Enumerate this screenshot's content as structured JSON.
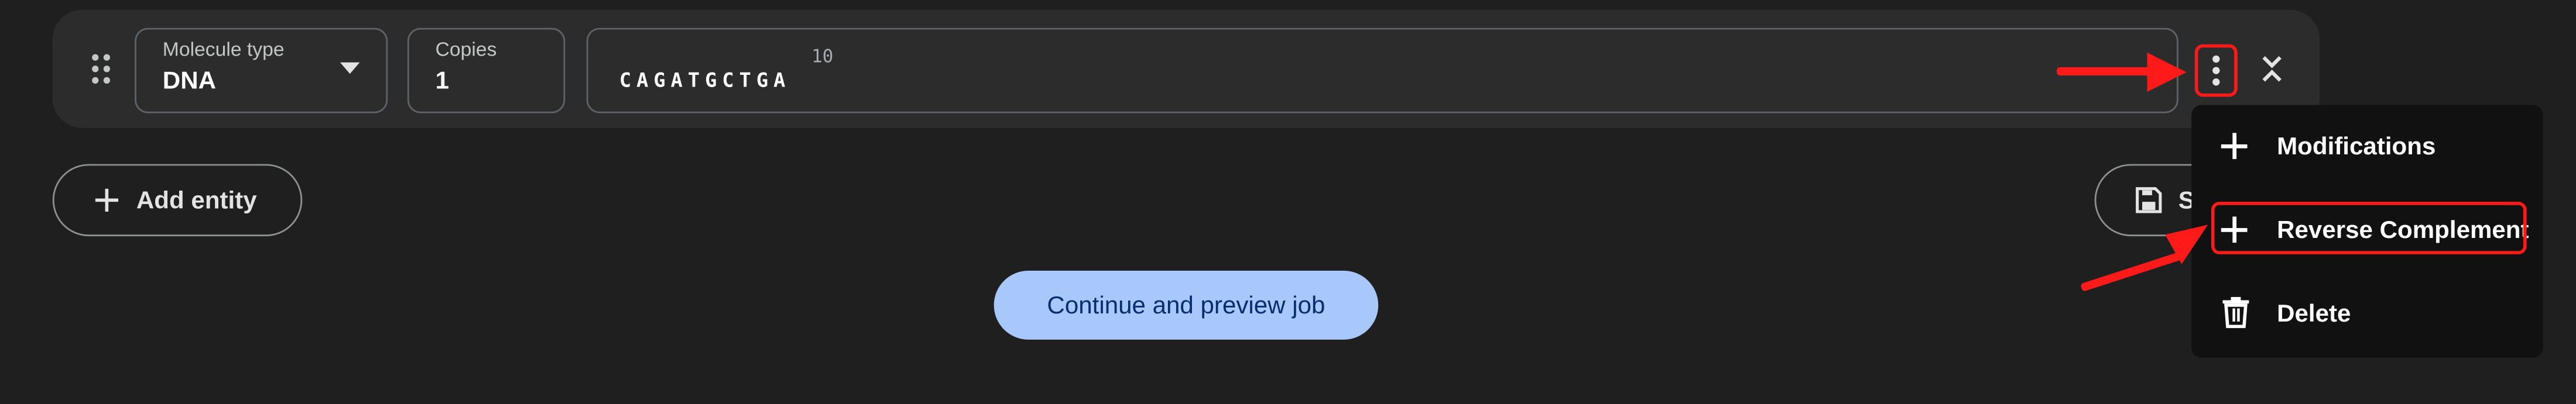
{
  "entity": {
    "molecule_type": {
      "label": "Molecule type",
      "value": "DNA"
    },
    "copies": {
      "label": "Copies",
      "value": "1"
    },
    "sequence": {
      "ruler": "10",
      "value": "CAGATGCTGA"
    }
  },
  "actions": {
    "add_entity_label": "Add entity",
    "save_label_partial": "S",
    "continue_label": "Continue and preview job"
  },
  "menu": {
    "items": [
      {
        "label": "Modifications",
        "icon": "plus-icon"
      },
      {
        "label": "Reverse Complement",
        "icon": "plus-icon"
      },
      {
        "label": "Delete",
        "icon": "trash-icon"
      }
    ]
  },
  "colors": {
    "background": "#1f1f1f",
    "card": "#2c2c2c",
    "primary_button": "#a8c7fa",
    "annotation_red": "#ff1a1a"
  }
}
